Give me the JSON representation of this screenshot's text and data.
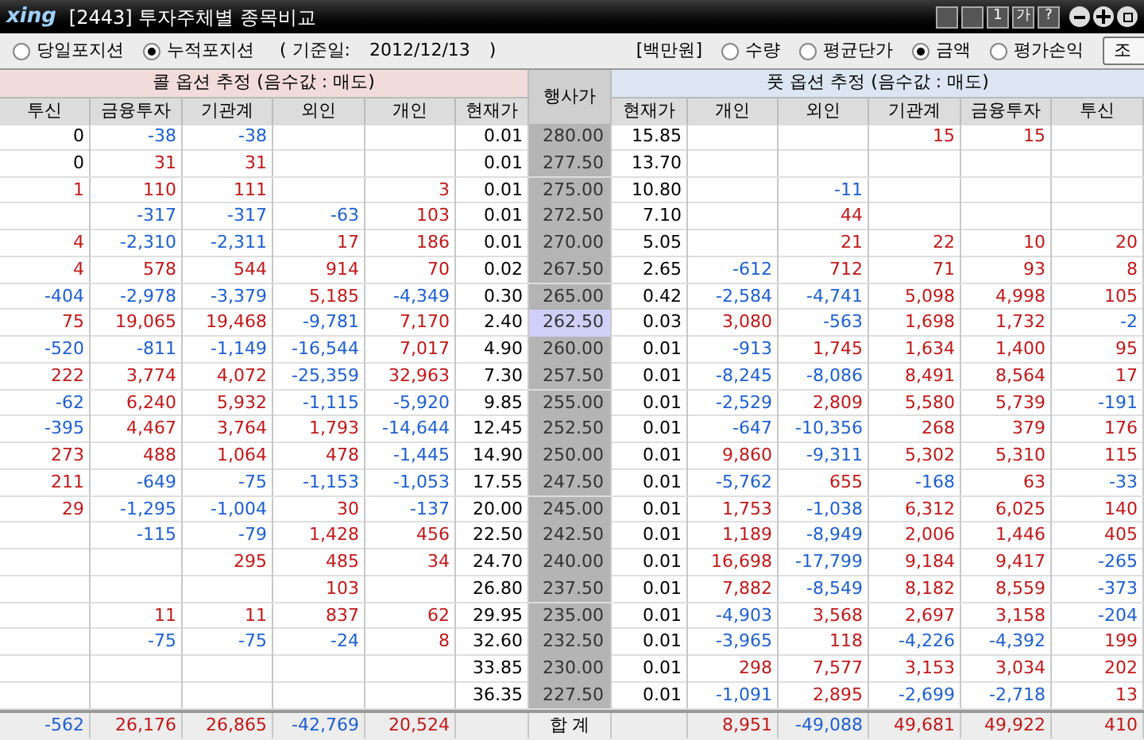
{
  "window": {
    "logo": "xing",
    "title": "[2443] 투자주체별 종목비교",
    "tool_buttons": [
      "1",
      "가",
      "?"
    ]
  },
  "position_options": [
    {
      "label": "당일포지션",
      "selected": false
    },
    {
      "label": "누적포지션",
      "selected": true
    }
  ],
  "base_date": {
    "label": "( 기준일:",
    "value": "2012/12/13",
    "close": ")"
  },
  "unit": "[백만원]",
  "value_options": [
    {
      "label": "수량",
      "selected": false
    },
    {
      "label": "평균단가",
      "selected": false
    },
    {
      "label": "금액",
      "selected": true
    },
    {
      "label": "평가손익",
      "selected": false
    }
  ],
  "query_button": "조",
  "table": {
    "call_title": "콜 옵션 추정 (음수값 : 매도)",
    "strike_title": "행사가",
    "put_title": "풋 옵션 추정 (음수값 : 매도)",
    "call_columns": [
      "투신",
      "금융투자",
      "기관계",
      "외인",
      "개인",
      "현재가"
    ],
    "put_columns": [
      "현재가",
      "개인",
      "외인",
      "기관계",
      "금융투자",
      "투신"
    ],
    "rows": [
      {
        "call": {
          "trust": "0",
          "financial": "-38",
          "institutions": "-38",
          "price": "0.01"
        },
        "strike": "280.00",
        "put": {
          "price": "15.85",
          "institutions": "15",
          "financial": "15"
        },
        "selected": false
      },
      {
        "call": {
          "trust": "0",
          "financial": "31",
          "institutions": "31",
          "price": "0.01"
        },
        "strike": "277.50",
        "put": {
          "price": "13.70"
        },
        "selected": false
      },
      {
        "call": {
          "trust": "1",
          "financial": "110",
          "institutions": "111",
          "individual": "3",
          "price": "0.01"
        },
        "strike": "275.00",
        "put": {
          "price": "10.80",
          "foreign": "-11"
        },
        "selected": false
      },
      {
        "call": {
          "financial": "-317",
          "institutions": "-317",
          "foreign": "-63",
          "individual": "103",
          "price": "0.01"
        },
        "strike": "272.50",
        "put": {
          "price": "7.10",
          "foreign": "44"
        },
        "selected": false
      },
      {
        "call": {
          "trust": "4",
          "financial": "-2,310",
          "institutions": "-2,311",
          "foreign": "17",
          "individual": "186",
          "price": "0.01"
        },
        "strike": "270.00",
        "put": {
          "price": "5.05",
          "foreign": "21",
          "institutions": "22",
          "financial": "10",
          "trust": "20"
        },
        "selected": false
      },
      {
        "call": {
          "trust": "4",
          "financial": "578",
          "institutions": "544",
          "foreign": "914",
          "individual": "70",
          "price": "0.02"
        },
        "strike": "267.50",
        "put": {
          "price": "2.65",
          "individual": "-612",
          "foreign": "712",
          "institutions": "71",
          "financial": "93",
          "trust": "8"
        },
        "selected": false
      },
      {
        "call": {
          "trust": "-404",
          "financial": "-2,978",
          "institutions": "-3,379",
          "foreign": "5,185",
          "individual": "-4,349",
          "price": "0.30"
        },
        "strike": "265.00",
        "put": {
          "price": "0.42",
          "individual": "-2,584",
          "foreign": "-4,741",
          "institutions": "5,098",
          "financial": "4,998",
          "trust": "105"
        },
        "selected": false
      },
      {
        "call": {
          "trust": "75",
          "financial": "19,065",
          "institutions": "19,468",
          "foreign": "-9,781",
          "individual": "7,170",
          "price": "2.40"
        },
        "strike": "262.50",
        "put": {
          "price": "0.03",
          "individual": "3,080",
          "foreign": "-563",
          "institutions": "1,698",
          "financial": "1,732",
          "trust": "-2"
        },
        "selected": true
      },
      {
        "call": {
          "trust": "-520",
          "financial": "-811",
          "institutions": "-1,149",
          "foreign": "-16,544",
          "individual": "7,017",
          "price": "4.90"
        },
        "strike": "260.00",
        "put": {
          "price": "0.01",
          "individual": "-913",
          "foreign": "1,745",
          "institutions": "1,634",
          "financial": "1,400",
          "trust": "95"
        },
        "selected": false
      },
      {
        "call": {
          "trust": "222",
          "financial": "3,774",
          "institutions": "4,072",
          "foreign": "-25,359",
          "individual": "32,963",
          "price": "7.30"
        },
        "strike": "257.50",
        "put": {
          "price": "0.01",
          "individual": "-8,245",
          "foreign": "-8,086",
          "institutions": "8,491",
          "financial": "8,564",
          "trust": "17"
        },
        "selected": false
      },
      {
        "call": {
          "trust": "-62",
          "financial": "6,240",
          "institutions": "5,932",
          "foreign": "-1,115",
          "individual": "-5,920",
          "price": "9.85"
        },
        "strike": "255.00",
        "put": {
          "price": "0.01",
          "individual": "-2,529",
          "foreign": "2,809",
          "institutions": "5,580",
          "financial": "5,739",
          "trust": "-191"
        },
        "selected": false
      },
      {
        "call": {
          "trust": "-395",
          "financial": "4,467",
          "institutions": "3,764",
          "foreign": "1,793",
          "individual": "-14,644",
          "price": "12.45"
        },
        "strike": "252.50",
        "put": {
          "price": "0.01",
          "individual": "-647",
          "foreign": "-10,356",
          "institutions": "268",
          "financial": "379",
          "trust": "176"
        },
        "selected": false
      },
      {
        "call": {
          "trust": "273",
          "financial": "488",
          "institutions": "1,064",
          "foreign": "478",
          "individual": "-1,445",
          "price": "14.90"
        },
        "strike": "250.00",
        "put": {
          "price": "0.01",
          "individual": "9,860",
          "foreign": "-9,311",
          "institutions": "5,302",
          "financial": "5,310",
          "trust": "115"
        },
        "selected": false
      },
      {
        "call": {
          "trust": "211",
          "financial": "-649",
          "institutions": "-75",
          "foreign": "-1,153",
          "individual": "-1,053",
          "price": "17.55"
        },
        "strike": "247.50",
        "put": {
          "price": "0.01",
          "individual": "-5,762",
          "foreign": "655",
          "institutions": "-168",
          "financial": "63",
          "trust": "-33"
        },
        "selected": false
      },
      {
        "call": {
          "trust": "29",
          "financial": "-1,295",
          "institutions": "-1,004",
          "foreign": "30",
          "individual": "-137",
          "price": "20.00"
        },
        "strike": "245.00",
        "put": {
          "price": "0.01",
          "individual": "1,753",
          "foreign": "-1,038",
          "institutions": "6,312",
          "financial": "6,025",
          "trust": "140"
        },
        "selected": false
      },
      {
        "call": {
          "financial": "-115",
          "institutions": "-79",
          "foreign": "1,428",
          "individual": "456",
          "price": "22.50"
        },
        "strike": "242.50",
        "put": {
          "price": "0.01",
          "individual": "1,189",
          "foreign": "-8,949",
          "institutions": "2,006",
          "financial": "1,446",
          "trust": "405"
        },
        "selected": false
      },
      {
        "call": {
          "institutions": "295",
          "foreign": "485",
          "individual": "34",
          "price": "24.70"
        },
        "strike": "240.00",
        "put": {
          "price": "0.01",
          "individual": "16,698",
          "foreign": "-17,799",
          "institutions": "9,184",
          "financial": "9,417",
          "trust": "-265"
        },
        "selected": false
      },
      {
        "call": {
          "foreign": "103",
          "price": "26.80"
        },
        "strike": "237.50",
        "put": {
          "price": "0.01",
          "individual": "7,882",
          "foreign": "-8,549",
          "institutions": "8,182",
          "financial": "8,559",
          "trust": "-373"
        },
        "selected": false
      },
      {
        "call": {
          "financial": "11",
          "institutions": "11",
          "foreign": "837",
          "individual": "62",
          "price": "29.95"
        },
        "strike": "235.00",
        "put": {
          "price": "0.01",
          "individual": "-4,903",
          "foreign": "3,568",
          "institutions": "2,697",
          "financial": "3,158",
          "trust": "-204"
        },
        "selected": false
      },
      {
        "call": {
          "financial": "-75",
          "institutions": "-75",
          "foreign": "-24",
          "individual": "8",
          "price": "32.60"
        },
        "strike": "232.50",
        "put": {
          "price": "0.01",
          "individual": "-3,965",
          "foreign": "118",
          "institutions": "-4,226",
          "financial": "-4,392",
          "trust": "199"
        },
        "selected": false
      },
      {
        "call": {
          "price": "33.85"
        },
        "strike": "230.00",
        "put": {
          "price": "0.01",
          "individual": "298",
          "foreign": "7,577",
          "institutions": "3,153",
          "financial": "3,034",
          "trust": "202"
        },
        "selected": false
      },
      {
        "call": {
          "price": "36.35"
        },
        "strike": "227.50",
        "put": {
          "price": "0.01",
          "individual": "-1,091",
          "foreign": "2,895",
          "institutions": "-2,699",
          "financial": "-2,718",
          "trust": "13"
        },
        "selected": false
      }
    ],
    "total": {
      "call": {
        "trust": "-562",
        "financial": "26,176",
        "institutions": "26,865",
        "foreign": "-42,769",
        "individual": "20,524"
      },
      "label": "합 계",
      "put": {
        "individual": "8,951",
        "foreign": "-49,088",
        "institutions": "49,681",
        "financial": "49,922",
        "trust": "410"
      }
    }
  }
}
